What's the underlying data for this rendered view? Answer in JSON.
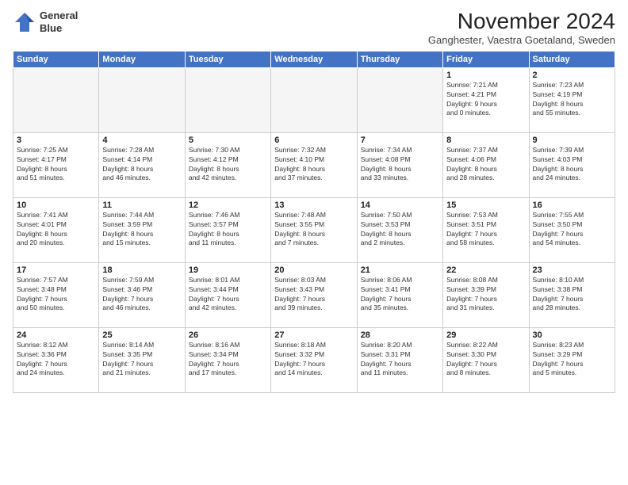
{
  "header": {
    "logo_line1": "General",
    "logo_line2": "Blue",
    "month": "November 2024",
    "location": "Ganghester, Vaestra Goetaland, Sweden"
  },
  "weekdays": [
    "Sunday",
    "Monday",
    "Tuesday",
    "Wednesday",
    "Thursday",
    "Friday",
    "Saturday"
  ],
  "weeks": [
    [
      {
        "day": "",
        "info": ""
      },
      {
        "day": "",
        "info": ""
      },
      {
        "day": "",
        "info": ""
      },
      {
        "day": "",
        "info": ""
      },
      {
        "day": "",
        "info": ""
      },
      {
        "day": "1",
        "info": "Sunrise: 7:21 AM\nSunset: 4:21 PM\nDaylight: 9 hours\nand 0 minutes."
      },
      {
        "day": "2",
        "info": "Sunrise: 7:23 AM\nSunset: 4:19 PM\nDaylight: 8 hours\nand 55 minutes."
      }
    ],
    [
      {
        "day": "3",
        "info": "Sunrise: 7:25 AM\nSunset: 4:17 PM\nDaylight: 8 hours\nand 51 minutes."
      },
      {
        "day": "4",
        "info": "Sunrise: 7:28 AM\nSunset: 4:14 PM\nDaylight: 8 hours\nand 46 minutes."
      },
      {
        "day": "5",
        "info": "Sunrise: 7:30 AM\nSunset: 4:12 PM\nDaylight: 8 hours\nand 42 minutes."
      },
      {
        "day": "6",
        "info": "Sunrise: 7:32 AM\nSunset: 4:10 PM\nDaylight: 8 hours\nand 37 minutes."
      },
      {
        "day": "7",
        "info": "Sunrise: 7:34 AM\nSunset: 4:08 PM\nDaylight: 8 hours\nand 33 minutes."
      },
      {
        "day": "8",
        "info": "Sunrise: 7:37 AM\nSunset: 4:06 PM\nDaylight: 8 hours\nand 28 minutes."
      },
      {
        "day": "9",
        "info": "Sunrise: 7:39 AM\nSunset: 4:03 PM\nDaylight: 8 hours\nand 24 minutes."
      }
    ],
    [
      {
        "day": "10",
        "info": "Sunrise: 7:41 AM\nSunset: 4:01 PM\nDaylight: 8 hours\nand 20 minutes."
      },
      {
        "day": "11",
        "info": "Sunrise: 7:44 AM\nSunset: 3:59 PM\nDaylight: 8 hours\nand 15 minutes."
      },
      {
        "day": "12",
        "info": "Sunrise: 7:46 AM\nSunset: 3:57 PM\nDaylight: 8 hours\nand 11 minutes."
      },
      {
        "day": "13",
        "info": "Sunrise: 7:48 AM\nSunset: 3:55 PM\nDaylight: 8 hours\nand 7 minutes."
      },
      {
        "day": "14",
        "info": "Sunrise: 7:50 AM\nSunset: 3:53 PM\nDaylight: 8 hours\nand 2 minutes."
      },
      {
        "day": "15",
        "info": "Sunrise: 7:53 AM\nSunset: 3:51 PM\nDaylight: 7 hours\nand 58 minutes."
      },
      {
        "day": "16",
        "info": "Sunrise: 7:55 AM\nSunset: 3:50 PM\nDaylight: 7 hours\nand 54 minutes."
      }
    ],
    [
      {
        "day": "17",
        "info": "Sunrise: 7:57 AM\nSunset: 3:48 PM\nDaylight: 7 hours\nand 50 minutes."
      },
      {
        "day": "18",
        "info": "Sunrise: 7:59 AM\nSunset: 3:46 PM\nDaylight: 7 hours\nand 46 minutes."
      },
      {
        "day": "19",
        "info": "Sunrise: 8:01 AM\nSunset: 3:44 PM\nDaylight: 7 hours\nand 42 minutes."
      },
      {
        "day": "20",
        "info": "Sunrise: 8:03 AM\nSunset: 3:43 PM\nDaylight: 7 hours\nand 39 minutes."
      },
      {
        "day": "21",
        "info": "Sunrise: 8:06 AM\nSunset: 3:41 PM\nDaylight: 7 hours\nand 35 minutes."
      },
      {
        "day": "22",
        "info": "Sunrise: 8:08 AM\nSunset: 3:39 PM\nDaylight: 7 hours\nand 31 minutes."
      },
      {
        "day": "23",
        "info": "Sunrise: 8:10 AM\nSunset: 3:38 PM\nDaylight: 7 hours\nand 28 minutes."
      }
    ],
    [
      {
        "day": "24",
        "info": "Sunrise: 8:12 AM\nSunset: 3:36 PM\nDaylight: 7 hours\nand 24 minutes."
      },
      {
        "day": "25",
        "info": "Sunrise: 8:14 AM\nSunset: 3:35 PM\nDaylight: 7 hours\nand 21 minutes."
      },
      {
        "day": "26",
        "info": "Sunrise: 8:16 AM\nSunset: 3:34 PM\nDaylight: 7 hours\nand 17 minutes."
      },
      {
        "day": "27",
        "info": "Sunrise: 8:18 AM\nSunset: 3:32 PM\nDaylight: 7 hours\nand 14 minutes."
      },
      {
        "day": "28",
        "info": "Sunrise: 8:20 AM\nSunset: 3:31 PM\nDaylight: 7 hours\nand 11 minutes."
      },
      {
        "day": "29",
        "info": "Sunrise: 8:22 AM\nSunset: 3:30 PM\nDaylight: 7 hours\nand 8 minutes."
      },
      {
        "day": "30",
        "info": "Sunrise: 8:23 AM\nSunset: 3:29 PM\nDaylight: 7 hours\nand 5 minutes."
      }
    ]
  ]
}
